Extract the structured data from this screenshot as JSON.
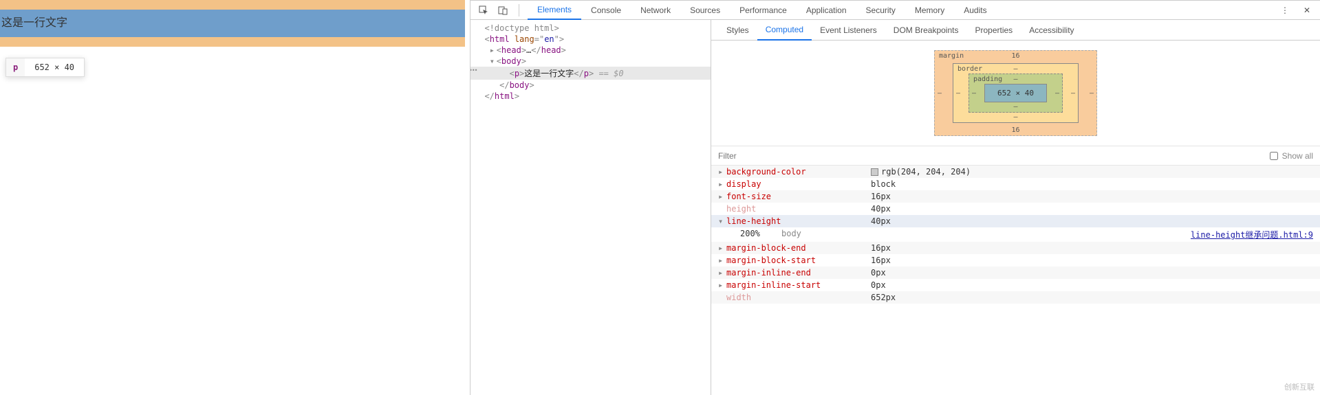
{
  "page": {
    "paragraph_text": "这是一行文字",
    "tooltip_tag": "p",
    "tooltip_dim": "652 × 40"
  },
  "toolbar": {
    "tabs": [
      "Elements",
      "Console",
      "Network",
      "Sources",
      "Performance",
      "Application",
      "Security",
      "Memory",
      "Audits"
    ],
    "active_tab": "Elements"
  },
  "dom": {
    "doctype": "<!doctype html>",
    "html_open": "html",
    "html_lang_attr": "lang",
    "html_lang_val": "en",
    "head": "head",
    "head_ellipsis": "…",
    "body": "body",
    "p_tag": "p",
    "p_text": "这是一行文字",
    "eq0": " == $0"
  },
  "side_tabs": [
    "Styles",
    "Computed",
    "Event Listeners",
    "DOM Breakpoints",
    "Properties",
    "Accessibility"
  ],
  "side_active": "Computed",
  "box_model": {
    "margin_label": "margin",
    "margin_top": "16",
    "margin_bottom": "16",
    "margin_left": "–",
    "margin_right": "–",
    "border_label": "border",
    "border_val": "–",
    "padding_label": "padding",
    "padding_val": "–",
    "content": "652 × 40"
  },
  "filter": {
    "placeholder": "Filter",
    "show_all": "Show all"
  },
  "computed": [
    {
      "prop": "background-color",
      "value": "rgb(204, 204, 204)",
      "swatch": true
    },
    {
      "prop": "display",
      "value": "block"
    },
    {
      "prop": "font-size",
      "value": "16px"
    },
    {
      "prop": "height",
      "value": "40px",
      "faded": true
    },
    {
      "prop": "line-height",
      "value": "40px",
      "expanded": true,
      "sub": {
        "v": "200%",
        "src": "body",
        "link": "line-height继承问题.html:9"
      }
    },
    {
      "prop": "margin-block-end",
      "value": "16px"
    },
    {
      "prop": "margin-block-start",
      "value": "16px"
    },
    {
      "prop": "margin-inline-end",
      "value": "0px"
    },
    {
      "prop": "margin-inline-start",
      "value": "0px"
    },
    {
      "prop": "width",
      "value": "652px",
      "faded": true
    }
  ],
  "watermark": "创新互联"
}
